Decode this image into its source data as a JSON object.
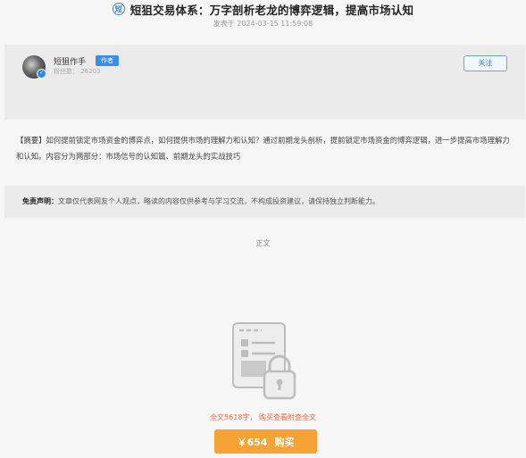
{
  "article": {
    "icon_text": "短",
    "title": "短狙交易体系：万字剖析老龙的博弈逻辑，提高市场认知",
    "publish_time": "发表于 2024-03-15 11:59:08"
  },
  "author": {
    "name": "短狙作手",
    "tag": "作者",
    "fans": "粉丝数： 26203",
    "follow_label": "关注",
    "badge_icon": "verified-check-icon"
  },
  "summary": {
    "label": "【摘要】",
    "text": "如何提前锁定市场资金的博弈点，如何提供市场的理解力和认知？通过前期龙头剖析，提前锁定市场资金的博弈逻辑，进一步提高市场理解力和认知。内容分为两部分：市场信号的认知篇、前期龙头的实战技巧"
  },
  "disclaimer": {
    "label": "免责声明：",
    "text": "文章仅代表网友个人观点，略读的内容仅供参考与学习交流，不构成投资建议，请保持独立判断能力。"
  },
  "section_label": "正文",
  "paywall": {
    "word_count_text": "全文5618字， 购买查看附查全文",
    "price": "￥654",
    "buy_label": "购买",
    "lock_icon": "locked-document-icon"
  },
  "colors": {
    "accent_blue": "#3b7fd8",
    "buy_orange": "#f6a234",
    "highlight_red": "#f06a4a"
  }
}
